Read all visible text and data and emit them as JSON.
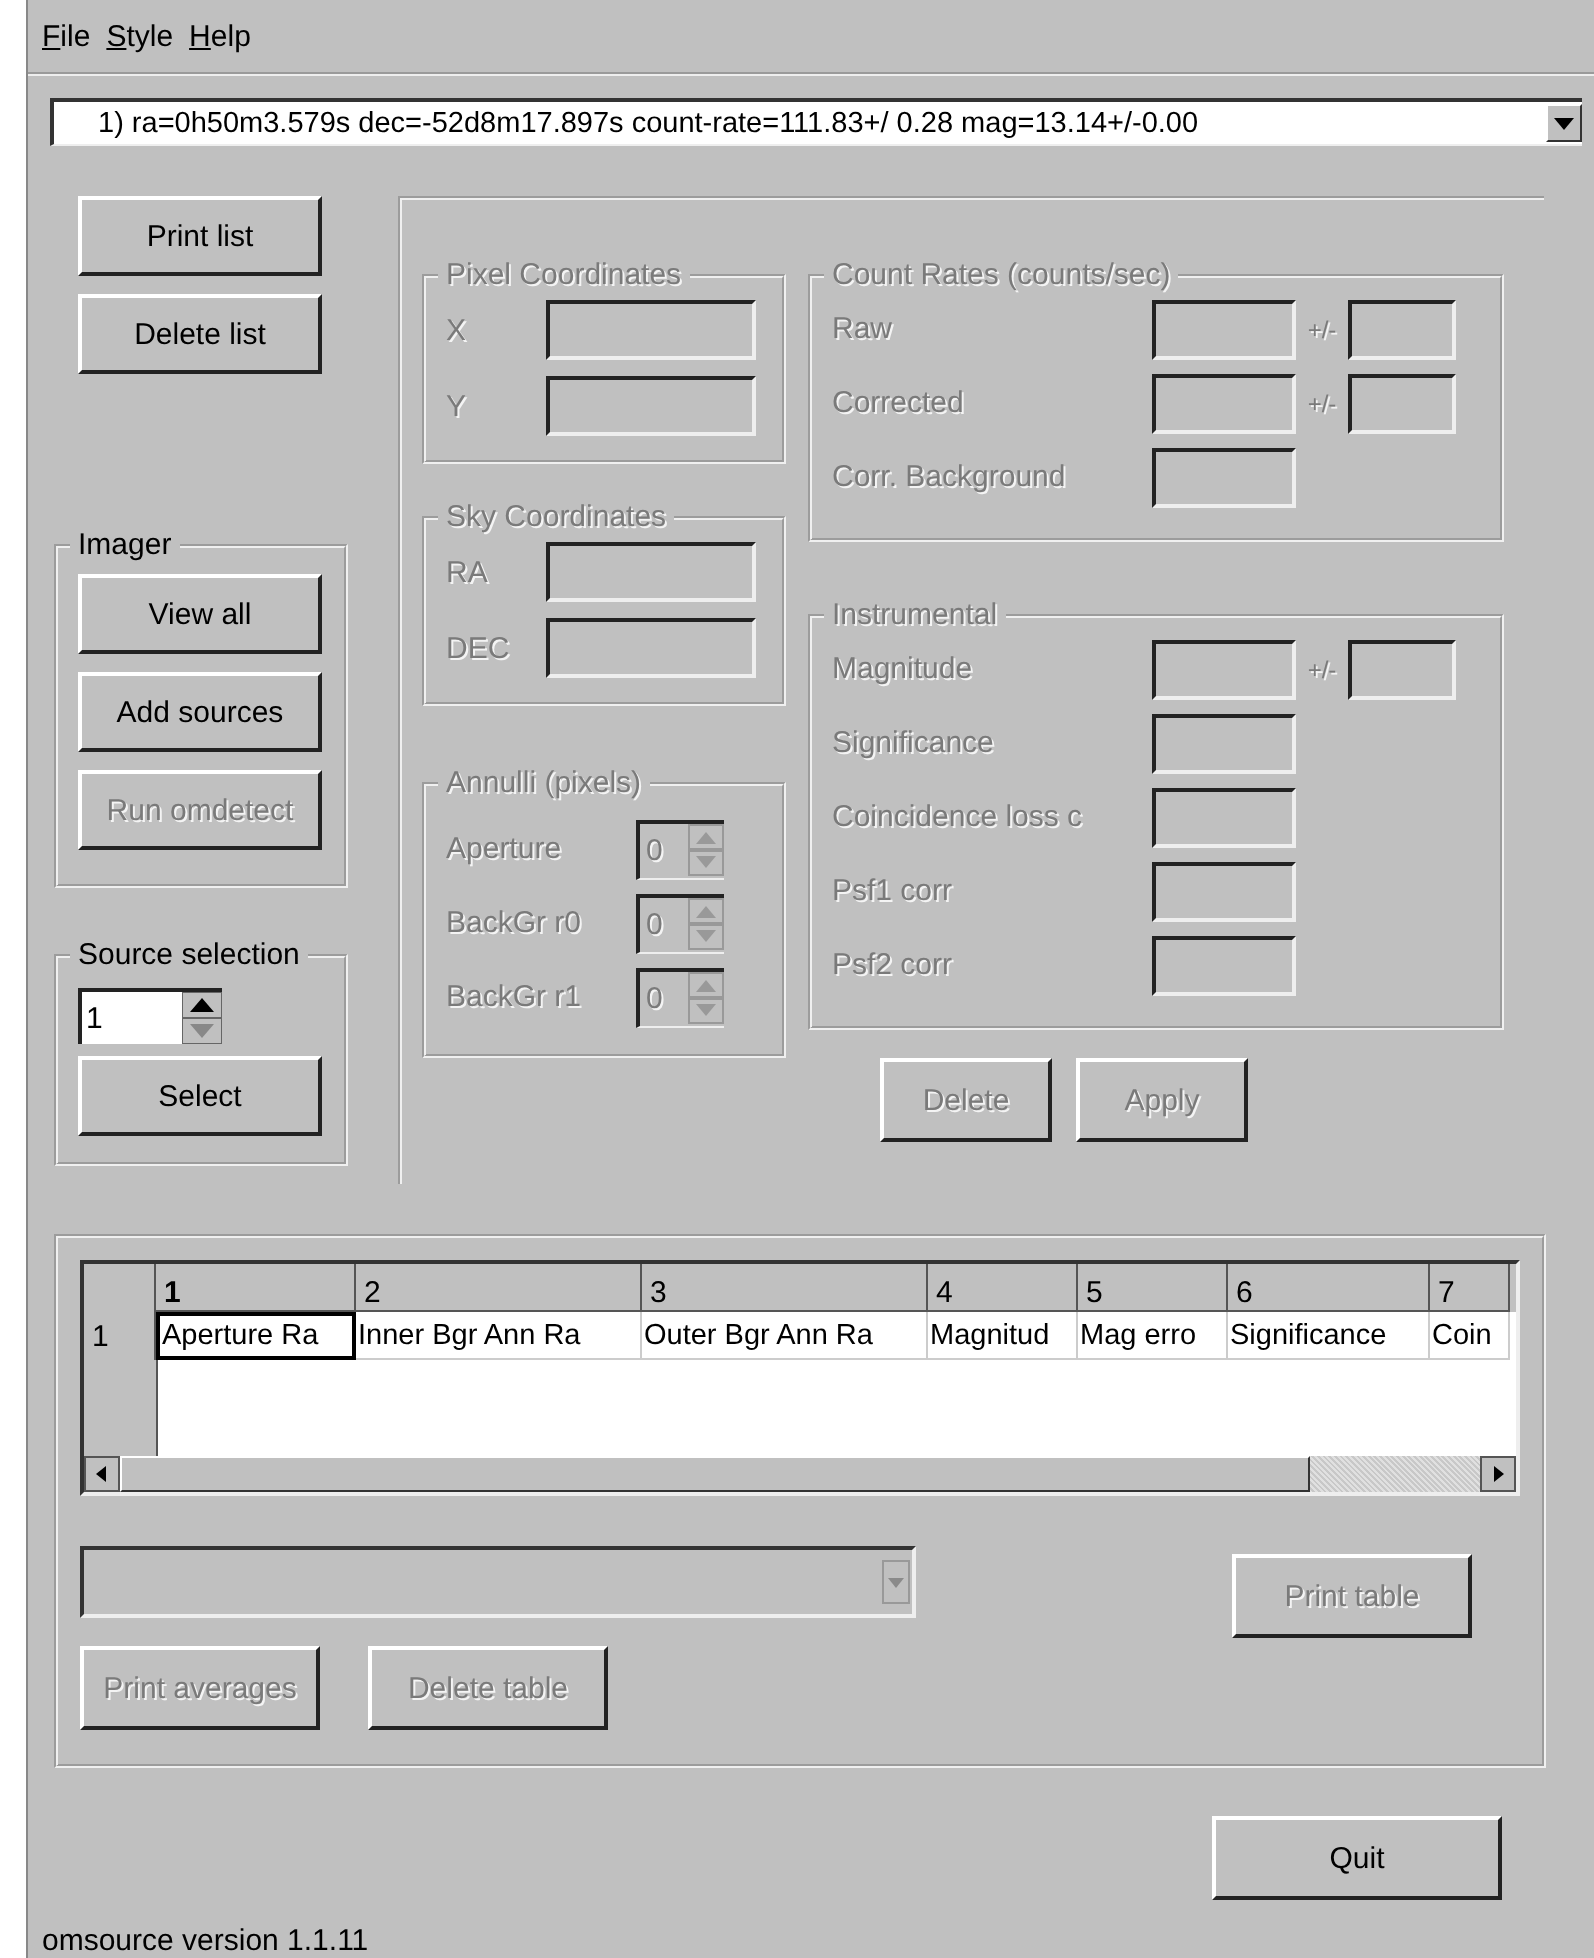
{
  "menu": [
    {
      "label": "File"
    },
    {
      "label": "Style"
    },
    {
      "label": "Help"
    }
  ],
  "source_list": {
    "value": "1) ra=0h50m3.579s dec=-52d8m17.897s count-rate=111.83+/ 0.28 mag=13.14+/-0.00"
  },
  "list_buttons": [
    {
      "label": "Print list",
      "disabled": false
    },
    {
      "label": "Delete list",
      "disabled": false
    }
  ],
  "imager": {
    "title": "Imager",
    "buttons": [
      {
        "label": "View all",
        "disabled": false
      },
      {
        "label": "Add sources",
        "disabled": false
      },
      {
        "label": "Run omdetect",
        "disabled": true
      }
    ]
  },
  "source_selection": {
    "title": "Source selection",
    "value": "1",
    "button": {
      "label": "Select",
      "disabled": false
    }
  },
  "pixel_coordinates": {
    "title": "Pixel Coordinates",
    "disabled": true,
    "fields": [
      {
        "label": "X"
      },
      {
        "label": "Y"
      }
    ]
  },
  "sky_coordinates": {
    "title": "Sky Coordinates",
    "disabled": true,
    "fields": [
      {
        "label": "RA"
      },
      {
        "label": "DEC"
      }
    ]
  },
  "annuli": {
    "title": "Annulli (pixels)",
    "disabled": true,
    "rows": [
      {
        "label": "Aperture",
        "value": "0"
      },
      {
        "label": "BackGr r0",
        "value": "0"
      },
      {
        "label": "BackGr r1",
        "value": "0"
      }
    ]
  },
  "count_rates": {
    "title": "Count Rates (counts/sec)",
    "disabled": true,
    "rows": [
      {
        "label": "Raw",
        "error_label": "+/-"
      },
      {
        "label": "Corrected",
        "error_label": "+/-"
      },
      {
        "label": "Corr. Background"
      }
    ]
  },
  "instrumental": {
    "title": "Instrumental",
    "disabled": true,
    "rows": [
      {
        "label": "Magnitude",
        "error_label": "+/-"
      },
      {
        "label": "Significance"
      },
      {
        "label": "Coincidence loss c"
      },
      {
        "label": "Psf1 corr"
      },
      {
        "label": "Psf2 corr"
      }
    ]
  },
  "source_buttons": [
    {
      "label": "Delete",
      "disabled": true
    },
    {
      "label": "Apply",
      "disabled": true
    }
  ],
  "table": {
    "columns": [
      {
        "label": "1",
        "selected": true
      },
      {
        "label": "2",
        "selected": false
      },
      {
        "label": "3",
        "selected": false
      },
      {
        "label": "4",
        "selected": false
      },
      {
        "label": "5",
        "selected": false
      },
      {
        "label": "6",
        "selected": false
      },
      {
        "label": "7",
        "selected": false
      }
    ],
    "rows": [
      {
        "header": "1",
        "cells": [
          {
            "text": "Aperture Ra",
            "selected": true
          },
          {
            "text": "Inner Bgr Ann Ra",
            "selected": false
          },
          {
            "text": "Outer Bgr Ann Ra",
            "selected": false
          },
          {
            "text": "Magnitud",
            "selected": false
          },
          {
            "text": "Mag erro",
            "selected": false
          },
          {
            "text": "Significance",
            "selected": false
          },
          {
            "text": "Coin",
            "selected": false
          }
        ]
      }
    ]
  },
  "table_select": {
    "disabled": true
  },
  "table_buttons": [
    {
      "label": "Print table",
      "disabled": true
    },
    {
      "label": "Print averages",
      "disabled": true
    },
    {
      "label": "Delete table",
      "disabled": true
    }
  ],
  "quit_button": {
    "label": "Quit",
    "disabled": false
  },
  "status": "omsource version 1.1.11"
}
